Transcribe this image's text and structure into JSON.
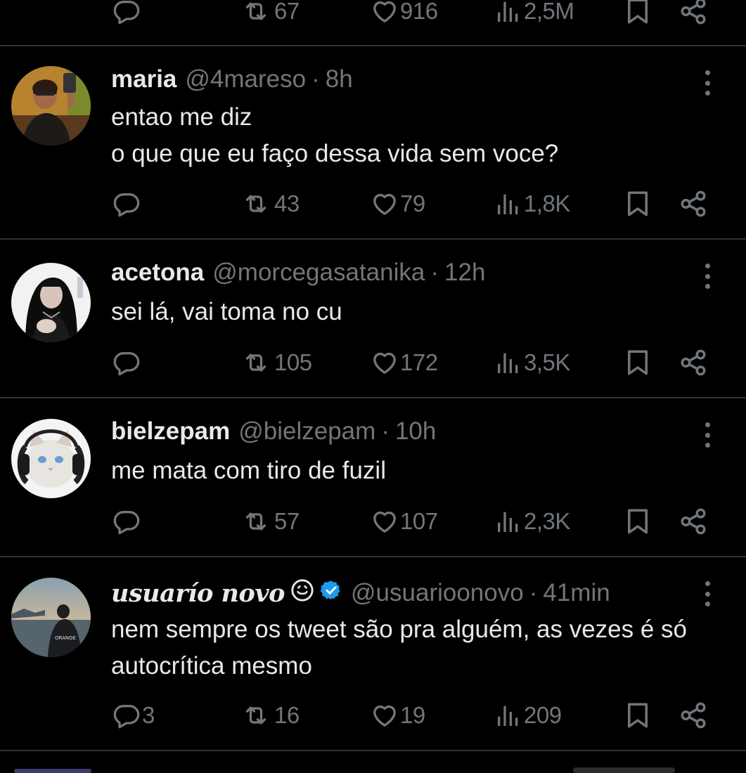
{
  "top_actions": {
    "replies": "",
    "reposts": "67",
    "likes": "916",
    "views": "2,5M"
  },
  "tweets": [
    {
      "name": "maria",
      "handle": "@4mareso",
      "time": "8h",
      "text": "entao me diz\no que que eu faço dessa vida sem voce?",
      "replies": "",
      "reposts": "43",
      "likes": "79",
      "views": "1,8K"
    },
    {
      "name": "acetona",
      "handle": "@morcegasatanika",
      "time": "12h",
      "text": "sei lá, vai toma no cu",
      "replies": "",
      "reposts": "105",
      "likes": "172",
      "views": "3,5K"
    },
    {
      "name": "bielzepam",
      "handle": "@bielzepam",
      "time": "10h",
      "text": "me mata com tiro de fuzil",
      "replies": "",
      "reposts": "57",
      "likes": "107",
      "views": "2,3K"
    },
    {
      "name": "usuarío novo",
      "handle": "@usuarioonovo",
      "time": "41min",
      "text": "nem sempre os tweet são pra alguém, as vezes é só\nautocrítica mesmo",
      "replies": "3",
      "reposts": "16",
      "likes": "19",
      "views": "209",
      "verified": true,
      "avatar_shirt_text": "ORANGE"
    }
  ],
  "separator": "·",
  "icons": {
    "reply": "reply-icon",
    "repost": "repost-icon",
    "like": "heart-icon",
    "views": "views-icon",
    "bookmark": "bookmark-icon",
    "share": "share-icon",
    "more": "more-icon",
    "verified": "verified-badge-icon"
  },
  "colors": {
    "background": "#000000",
    "text": "#e7e9ea",
    "muted": "#71767b",
    "divider": "#2f3336",
    "verified": "#1d9bf0"
  }
}
